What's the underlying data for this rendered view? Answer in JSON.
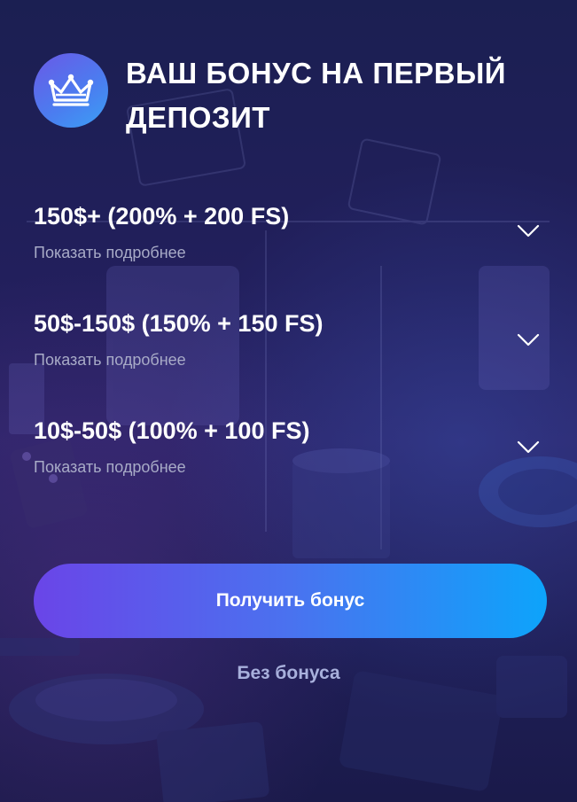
{
  "header": {
    "logo_icon": "crown-icon",
    "title": "ВАШ БОНУС НА ПЕРВЫЙ ДЕПОЗИТ"
  },
  "bonus_options": [
    {
      "title": "150$+ (200% + 200 FS)",
      "subtitle": "Показать подробнее",
      "icon": "chevron-down-icon"
    },
    {
      "title": "50$-150$ (150% + 150 FS)",
      "subtitle": "Показать подробнее",
      "icon": "chevron-down-icon"
    },
    {
      "title": "10$-50$ (100% + 100 FS)",
      "subtitle": "Показать подробнее",
      "icon": "chevron-down-icon"
    }
  ],
  "actions": {
    "get_bonus_label": "Получить бонус",
    "no_bonus_label": "Без бонуса"
  },
  "colors": {
    "background": "#1f1e56",
    "accent_start": "#6a45e8",
    "accent_end": "#0da4fb",
    "muted_text": "#a8abc7",
    "link_text": "#a8b0dc"
  }
}
